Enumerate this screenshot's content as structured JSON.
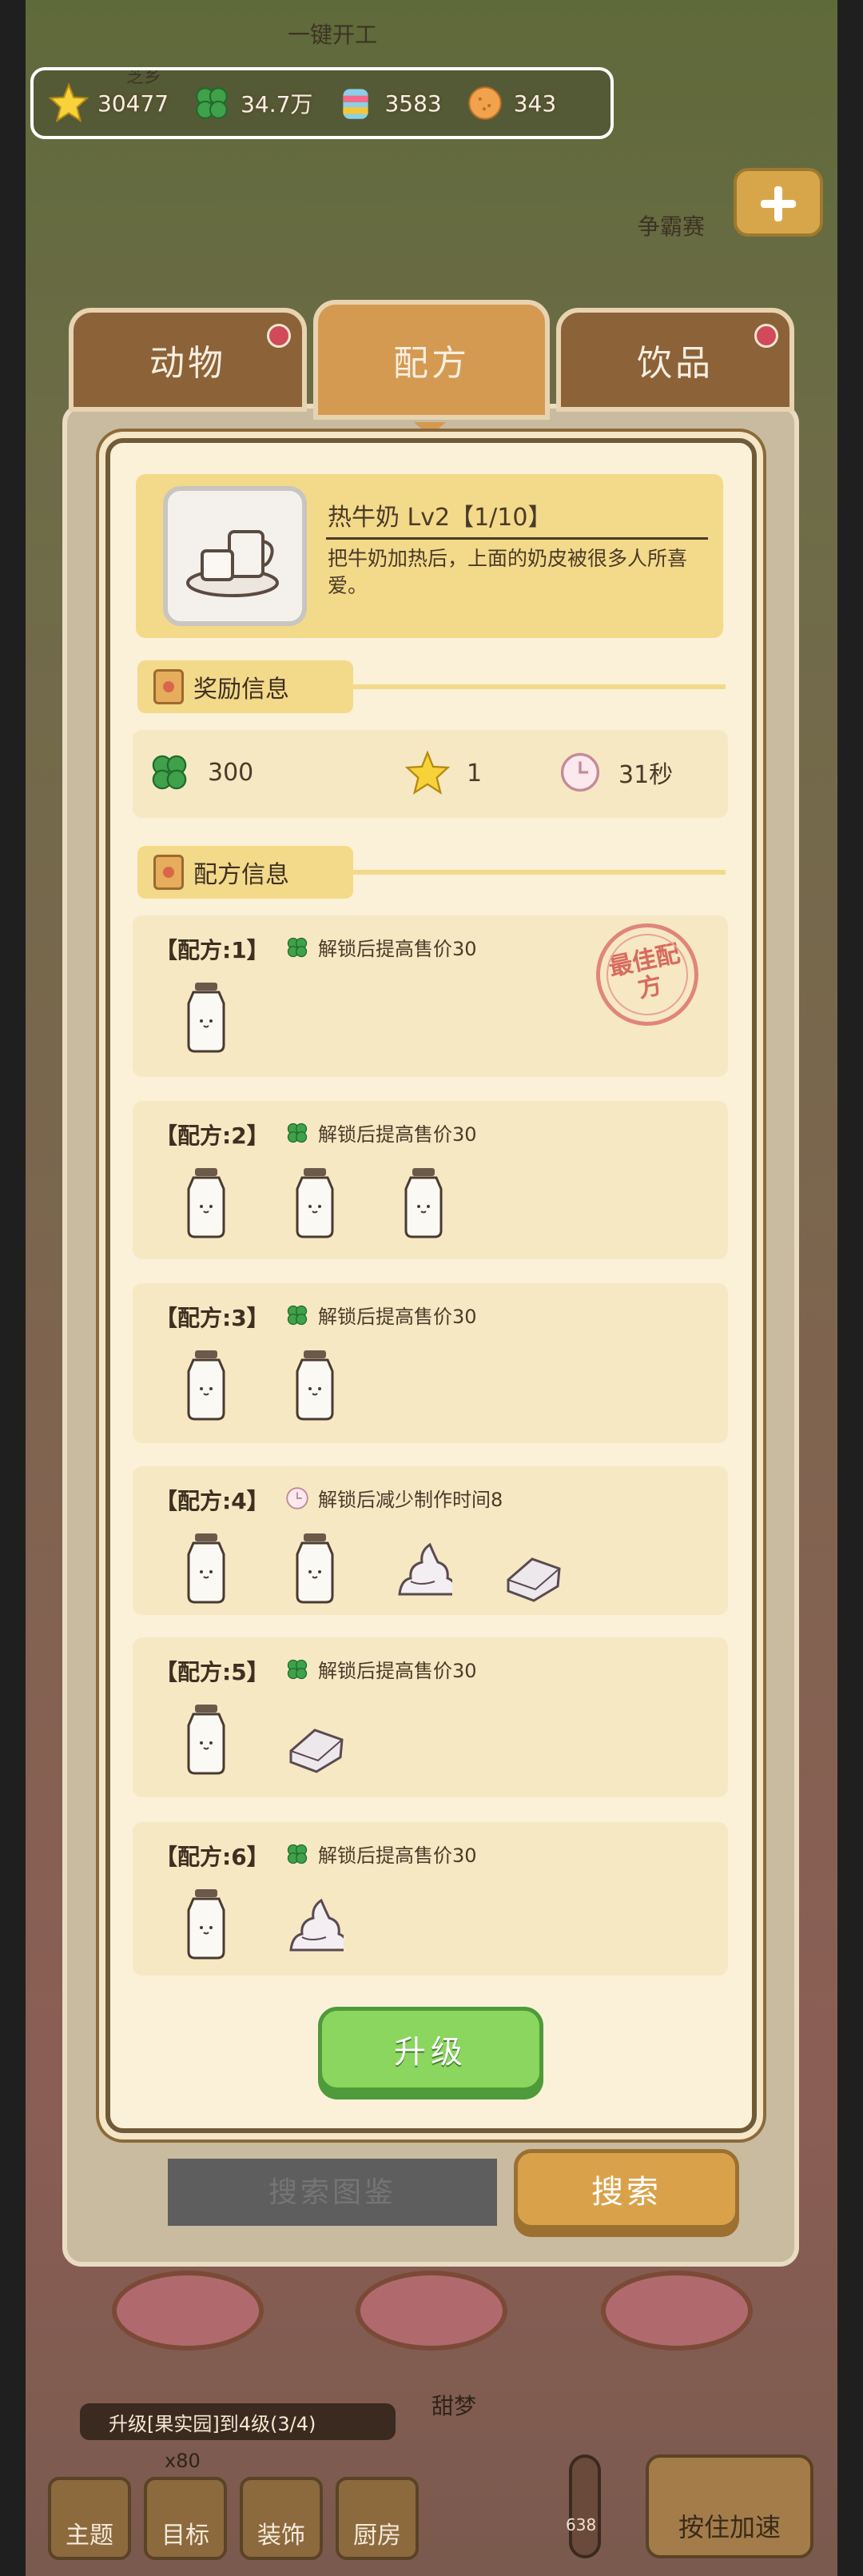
{
  "resources": [
    {
      "icon": "star-icon",
      "value": "30477"
    },
    {
      "icon": "clover-icon",
      "value": "34.7万"
    },
    {
      "icon": "candy-icon",
      "value": "3583"
    },
    {
      "icon": "cookie-icon",
      "value": "343"
    }
  ],
  "background": {
    "top_label": "一键开工",
    "side_label": "争霸赛",
    "cheese_label": "芝乡"
  },
  "tabs": [
    {
      "label": "动物",
      "active": false,
      "has_dot": true
    },
    {
      "label": "配方",
      "active": true,
      "has_dot": false
    },
    {
      "label": "饮品",
      "active": false,
      "has_dot": true
    }
  ],
  "recipe": {
    "title": "热牛奶 Lv2【1/10】",
    "description": "把牛奶加热后，上面的奶皮被很多人所喜爱。"
  },
  "reward_section": {
    "title": "奖励信息",
    "clover": "300",
    "star": "1",
    "time": "31秒"
  },
  "recipes_section": {
    "title": "配方信息",
    "stamp": "最佳配方",
    "items": [
      {
        "label": "【配方:1】",
        "icon": "clover-icon",
        "condition": "解锁后提高售价30",
        "ingredients": [
          "milk-bottle"
        ]
      },
      {
        "label": "【配方:2】",
        "icon": "clover-icon",
        "condition": "解锁后提高售价30",
        "ingredients": [
          "milk-bottle",
          "milk-bottle",
          "milk-bottle"
        ]
      },
      {
        "label": "【配方:3】",
        "icon": "clover-icon",
        "condition": "解锁后提高售价30",
        "ingredients": [
          "milk-bottle",
          "milk-bottle"
        ]
      },
      {
        "label": "【配方:4】",
        "icon": "clock-icon",
        "condition": "解锁后减少制作时间8",
        "ingredients": [
          "milk-bottle",
          "milk-bottle",
          "whipped-cream",
          "butter"
        ]
      },
      {
        "label": "【配方:5】",
        "icon": "clover-icon",
        "condition": "解锁后提高售价30",
        "ingredients": [
          "milk-bottle",
          "butter"
        ]
      },
      {
        "label": "【配方:6】",
        "icon": "clover-icon",
        "condition": "解锁后提高售价30",
        "ingredients": [
          "milk-bottle",
          "whipped-cream"
        ]
      }
    ]
  },
  "upgrade_label": "升级",
  "search": {
    "placeholder": "搜索图鉴",
    "button": "搜索"
  },
  "bottom": {
    "progress_text": "升级[果实园]到4级(3/4)",
    "sweet_label": "甜梦",
    "count_label": "x80",
    "nav": [
      "主题",
      "目标",
      "装饰",
      "厨房"
    ],
    "accelerate": "按住加速",
    "thermo_value": "638"
  },
  "colors": {
    "accent_green": "#8ad65e",
    "tab_brown": "#8c6238",
    "tab_active": "#d49a52",
    "card_yellow": "#f3d98a"
  }
}
